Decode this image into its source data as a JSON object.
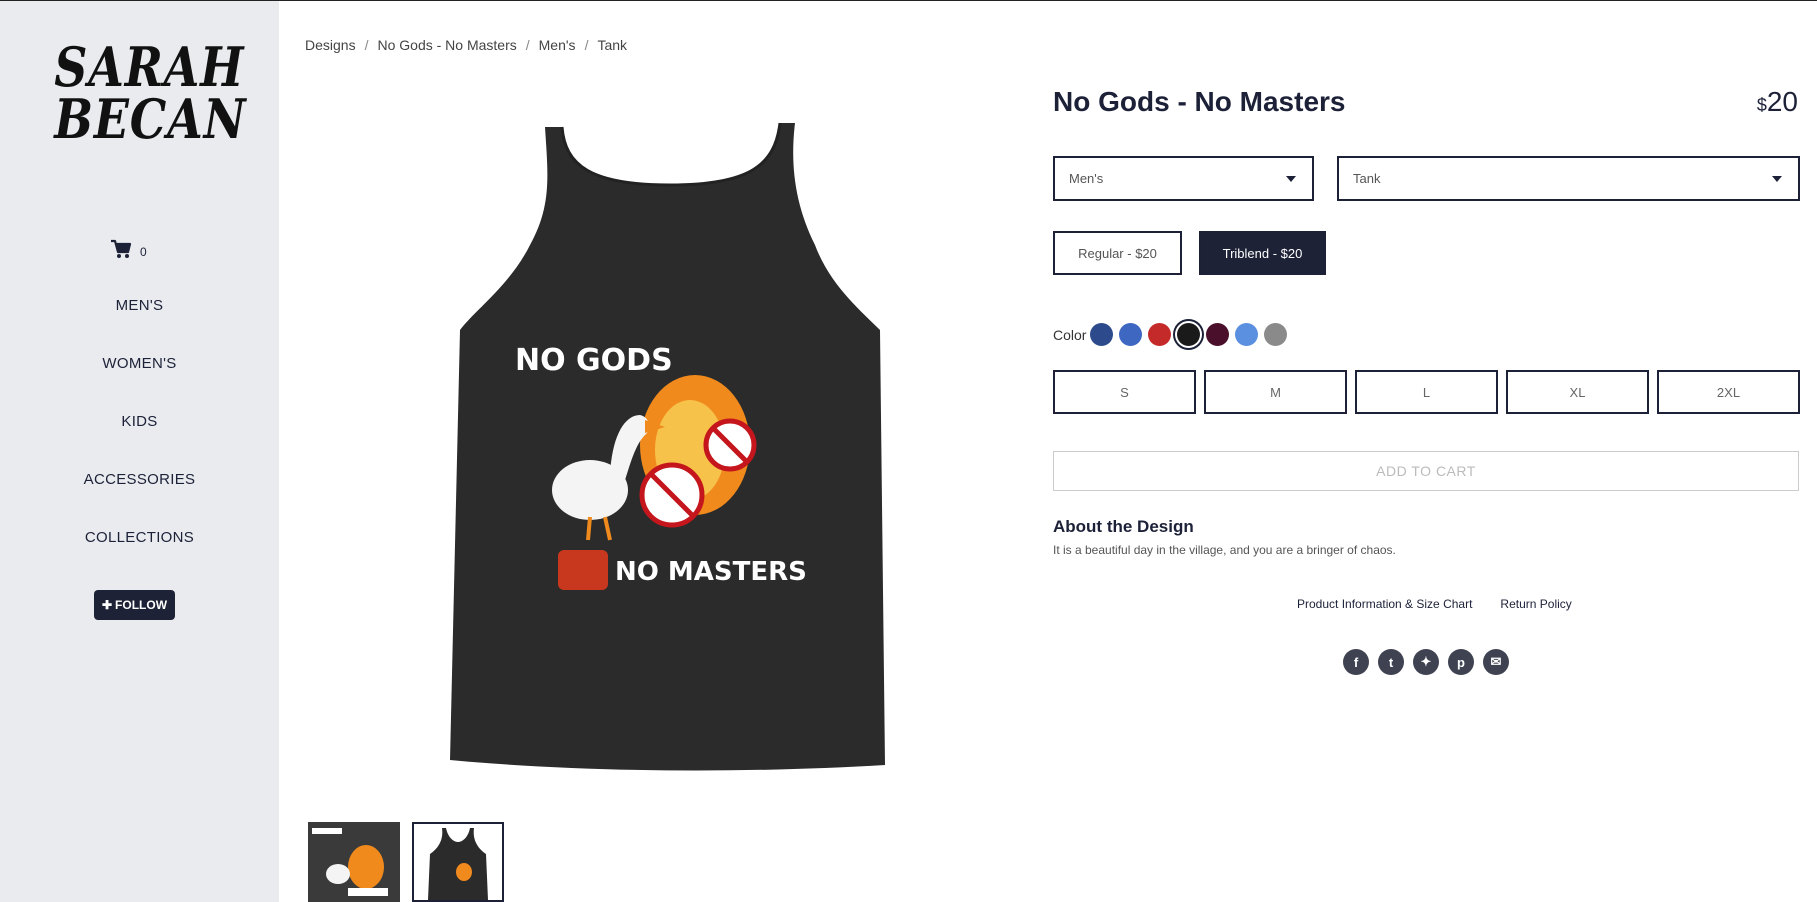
{
  "brand": {
    "logo_line1": "SARAH",
    "logo_line2": "BECAN"
  },
  "cart": {
    "count": "0"
  },
  "sidebar": {
    "items": [
      {
        "label": "MEN'S"
      },
      {
        "label": "WOMEN'S"
      },
      {
        "label": "KIDS"
      },
      {
        "label": "ACCESSORIES"
      },
      {
        "label": "COLLECTIONS"
      }
    ],
    "follow_label": "FOLLOW"
  },
  "breadcrumb": [
    "Designs",
    "No Gods - No Masters",
    "Men's",
    "Tank"
  ],
  "product": {
    "title": "No Gods - No Masters",
    "price_currency": "$",
    "price_value": "20",
    "gender_select": "Men's",
    "style_select": "Tank",
    "options": [
      "Regular - $20",
      "Triblend - $20"
    ],
    "selected_option": "Triblend - $20",
    "color_label": "Color",
    "colors": [
      "#2c4a8c",
      "#3d67c0",
      "#c42a2a",
      "#1a1a1a",
      "#4a0f2a",
      "#5b8fe0",
      "#8a8a8a"
    ],
    "selected_color_index": 3,
    "sizes": [
      "S",
      "M",
      "L",
      "XL",
      "2XL"
    ],
    "add_to_cart": "ADD TO CART",
    "about_title": "About the Design",
    "about_text": "It is a beautiful day in the village, and you are a bringer of chaos.",
    "links": [
      "Product Information & Size Chart",
      "Return Policy"
    ]
  },
  "artwork": {
    "text_top": "NO GODS",
    "text_bottom": "NO MASTERS"
  },
  "social": [
    "facebook-icon",
    "tumblr-icon",
    "twitter-icon",
    "pinterest-icon",
    "email-icon"
  ]
}
